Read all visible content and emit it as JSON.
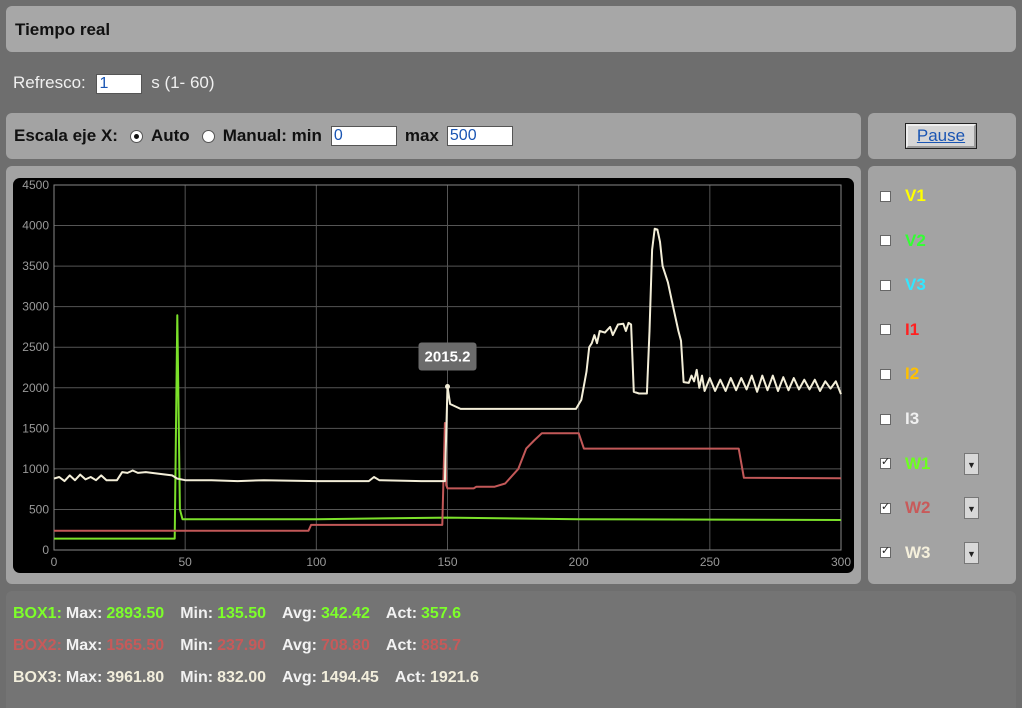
{
  "title": "Tiempo real",
  "refresh": {
    "label": "Refresco:",
    "value": "1",
    "range_text": "s (1- 60)"
  },
  "xscale": {
    "label": "Escala eje X:",
    "auto_label": "Auto",
    "manual_label": "Manual: min",
    "min_value": "0",
    "max_label": "max",
    "max_value": "500",
    "selected": "Auto"
  },
  "pause_label": "Pause",
  "legend": [
    {
      "label": "V1",
      "color": "#ffff00",
      "checked": false
    },
    {
      "label": "V2",
      "color": "#33ff33",
      "checked": false
    },
    {
      "label": "V3",
      "color": "#33e6ff",
      "checked": false
    },
    {
      "label": "I1",
      "color": "#ff2020",
      "checked": false
    },
    {
      "label": "I2",
      "color": "#ffc000",
      "checked": false
    },
    {
      "label": "I3",
      "color": "#f0f0f0",
      "checked": false
    },
    {
      "label": "W1",
      "color": "#6cff20",
      "checked": true,
      "dropdown": "▼"
    },
    {
      "label": "W2",
      "color": "#c85a5a",
      "checked": true,
      "dropdown": "▼"
    },
    {
      "label": "W3",
      "color": "#f5f0dc",
      "checked": true,
      "dropdown": "▼"
    }
  ],
  "chart_data": {
    "type": "line",
    "xlim": [
      0,
      300
    ],
    "ylim": [
      0,
      4500
    ],
    "x_ticks": [
      "0",
      "50",
      "100",
      "150",
      "200",
      "250",
      "300"
    ],
    "y_ticks": [
      "0",
      "500",
      "1000",
      "1500",
      "2000",
      "2500",
      "3000",
      "3500",
      "4000",
      "4500"
    ],
    "grid": true,
    "tooltip": {
      "text": "2015.2",
      "x": 150,
      "y": 2015.2
    },
    "series": [
      {
        "name": "W1",
        "color": "#7be02a",
        "points": [
          [
            0,
            140
          ],
          [
            46,
            140
          ],
          [
            47,
            2893.5
          ],
          [
            48,
            500
          ],
          [
            49,
            380
          ],
          [
            100,
            380
          ],
          [
            150,
            400
          ],
          [
            200,
            380
          ],
          [
            300,
            370
          ]
        ]
      },
      {
        "name": "W2",
        "color": "#c25858",
        "points": [
          [
            0,
            237.9
          ],
          [
            97,
            237.9
          ],
          [
            98,
            310
          ],
          [
            100,
            310
          ],
          [
            148,
            310
          ],
          [
            149,
            1565.5
          ],
          [
            149.5,
            800
          ],
          [
            150,
            760
          ],
          [
            160,
            760
          ],
          [
            161,
            780
          ],
          [
            168,
            780
          ],
          [
            172,
            820
          ],
          [
            177,
            1000
          ],
          [
            180,
            1250
          ],
          [
            183,
            1350
          ],
          [
            186,
            1440
          ],
          [
            200,
            1440
          ],
          [
            202,
            1250
          ],
          [
            261,
            1250
          ],
          [
            263,
            890
          ],
          [
            300,
            885.7
          ]
        ]
      },
      {
        "name": "W3",
        "color": "#f3eed8",
        "points": [
          [
            0,
            880
          ],
          [
            2,
            900
          ],
          [
            4,
            850
          ],
          [
            6,
            920
          ],
          [
            8,
            860
          ],
          [
            10,
            930
          ],
          [
            12,
            870
          ],
          [
            14,
            900
          ],
          [
            16,
            860
          ],
          [
            18,
            920
          ],
          [
            20,
            860
          ],
          [
            24,
            860
          ],
          [
            26,
            960
          ],
          [
            28,
            950
          ],
          [
            30,
            980
          ],
          [
            32,
            950
          ],
          [
            35,
            960
          ],
          [
            40,
            940
          ],
          [
            45,
            920
          ],
          [
            47,
            880
          ],
          [
            50,
            860
          ],
          [
            60,
            860
          ],
          [
            70,
            850
          ],
          [
            80,
            860
          ],
          [
            100,
            850
          ],
          [
            120,
            850
          ],
          [
            122,
            900
          ],
          [
            124,
            860
          ],
          [
            140,
            850
          ],
          [
            149,
            850
          ],
          [
            150,
            2015.2
          ],
          [
            151,
            1800
          ],
          [
            155,
            1740
          ],
          [
            190,
            1740
          ],
          [
            199,
            1740
          ],
          [
            201,
            1850
          ],
          [
            203,
            2200
          ],
          [
            204,
            2500
          ],
          [
            205,
            2550
          ],
          [
            206,
            2650
          ],
          [
            207,
            2550
          ],
          [
            208,
            2700
          ],
          [
            210,
            2680
          ],
          [
            212,
            2750
          ],
          [
            213,
            2650
          ],
          [
            215,
            2780
          ],
          [
            217,
            2790
          ],
          [
            218,
            2700
          ],
          [
            219,
            2800
          ],
          [
            220,
            2780
          ],
          [
            221,
            1950
          ],
          [
            223,
            1930
          ],
          [
            226,
            1930
          ],
          [
            227,
            2700
          ],
          [
            228,
            3700
          ],
          [
            229,
            3961.8
          ],
          [
            230,
            3950
          ],
          [
            231,
            3800
          ],
          [
            232,
            3500
          ],
          [
            234,
            3300
          ],
          [
            236,
            3000
          ],
          [
            238,
            2700
          ],
          [
            239,
            2580
          ],
          [
            240,
            2070
          ],
          [
            242,
            2060
          ],
          [
            243,
            2150
          ],
          [
            244,
            2080
          ],
          [
            245,
            2220
          ],
          [
            246,
            2000
          ],
          [
            247,
            2150
          ],
          [
            248,
            1960
          ],
          [
            250,
            2120
          ],
          [
            252,
            1960
          ],
          [
            254,
            2100
          ],
          [
            256,
            1960
          ],
          [
            258,
            2120
          ],
          [
            260,
            1970
          ],
          [
            262,
            2120
          ],
          [
            264,
            1980
          ],
          [
            266,
            2150
          ],
          [
            268,
            1950
          ],
          [
            270,
            2150
          ],
          [
            272,
            1970
          ],
          [
            274,
            2150
          ],
          [
            276,
            1960
          ],
          [
            278,
            2130
          ],
          [
            280,
            1970
          ],
          [
            282,
            2120
          ],
          [
            284,
            1980
          ],
          [
            286,
            2100
          ],
          [
            288,
            1980
          ],
          [
            290,
            2100
          ],
          [
            292,
            1960
          ],
          [
            294,
            2080
          ],
          [
            296,
            1990
          ],
          [
            298,
            2080
          ],
          [
            300,
            1921.6
          ]
        ]
      }
    ]
  },
  "stats": [
    {
      "box": "BOX1:",
      "color": "#7dff2a",
      "max_label": "Max:",
      "max": "2893.50",
      "min_label": "Min:",
      "min": "135.50",
      "avg_label": "Avg:",
      "avg": "342.42",
      "act_label": "Act:",
      "act": "357.6"
    },
    {
      "box": "BOX2:",
      "color": "#c65a5a",
      "max_label": "Max:",
      "max": "1565.50",
      "min_label": "Min:",
      "min": "237.90",
      "avg_label": "Avg:",
      "avg": "708.80",
      "act_label": "Act:",
      "act": "885.7"
    },
    {
      "box": "BOX3:",
      "color": "#f2eedc",
      "max_label": "Max:",
      "max": "3961.80",
      "min_label": "Min:",
      "min": "832.00",
      "avg_label": "Avg:",
      "avg": "1494.45",
      "act_label": "Act:",
      "act": "1921.6"
    }
  ]
}
